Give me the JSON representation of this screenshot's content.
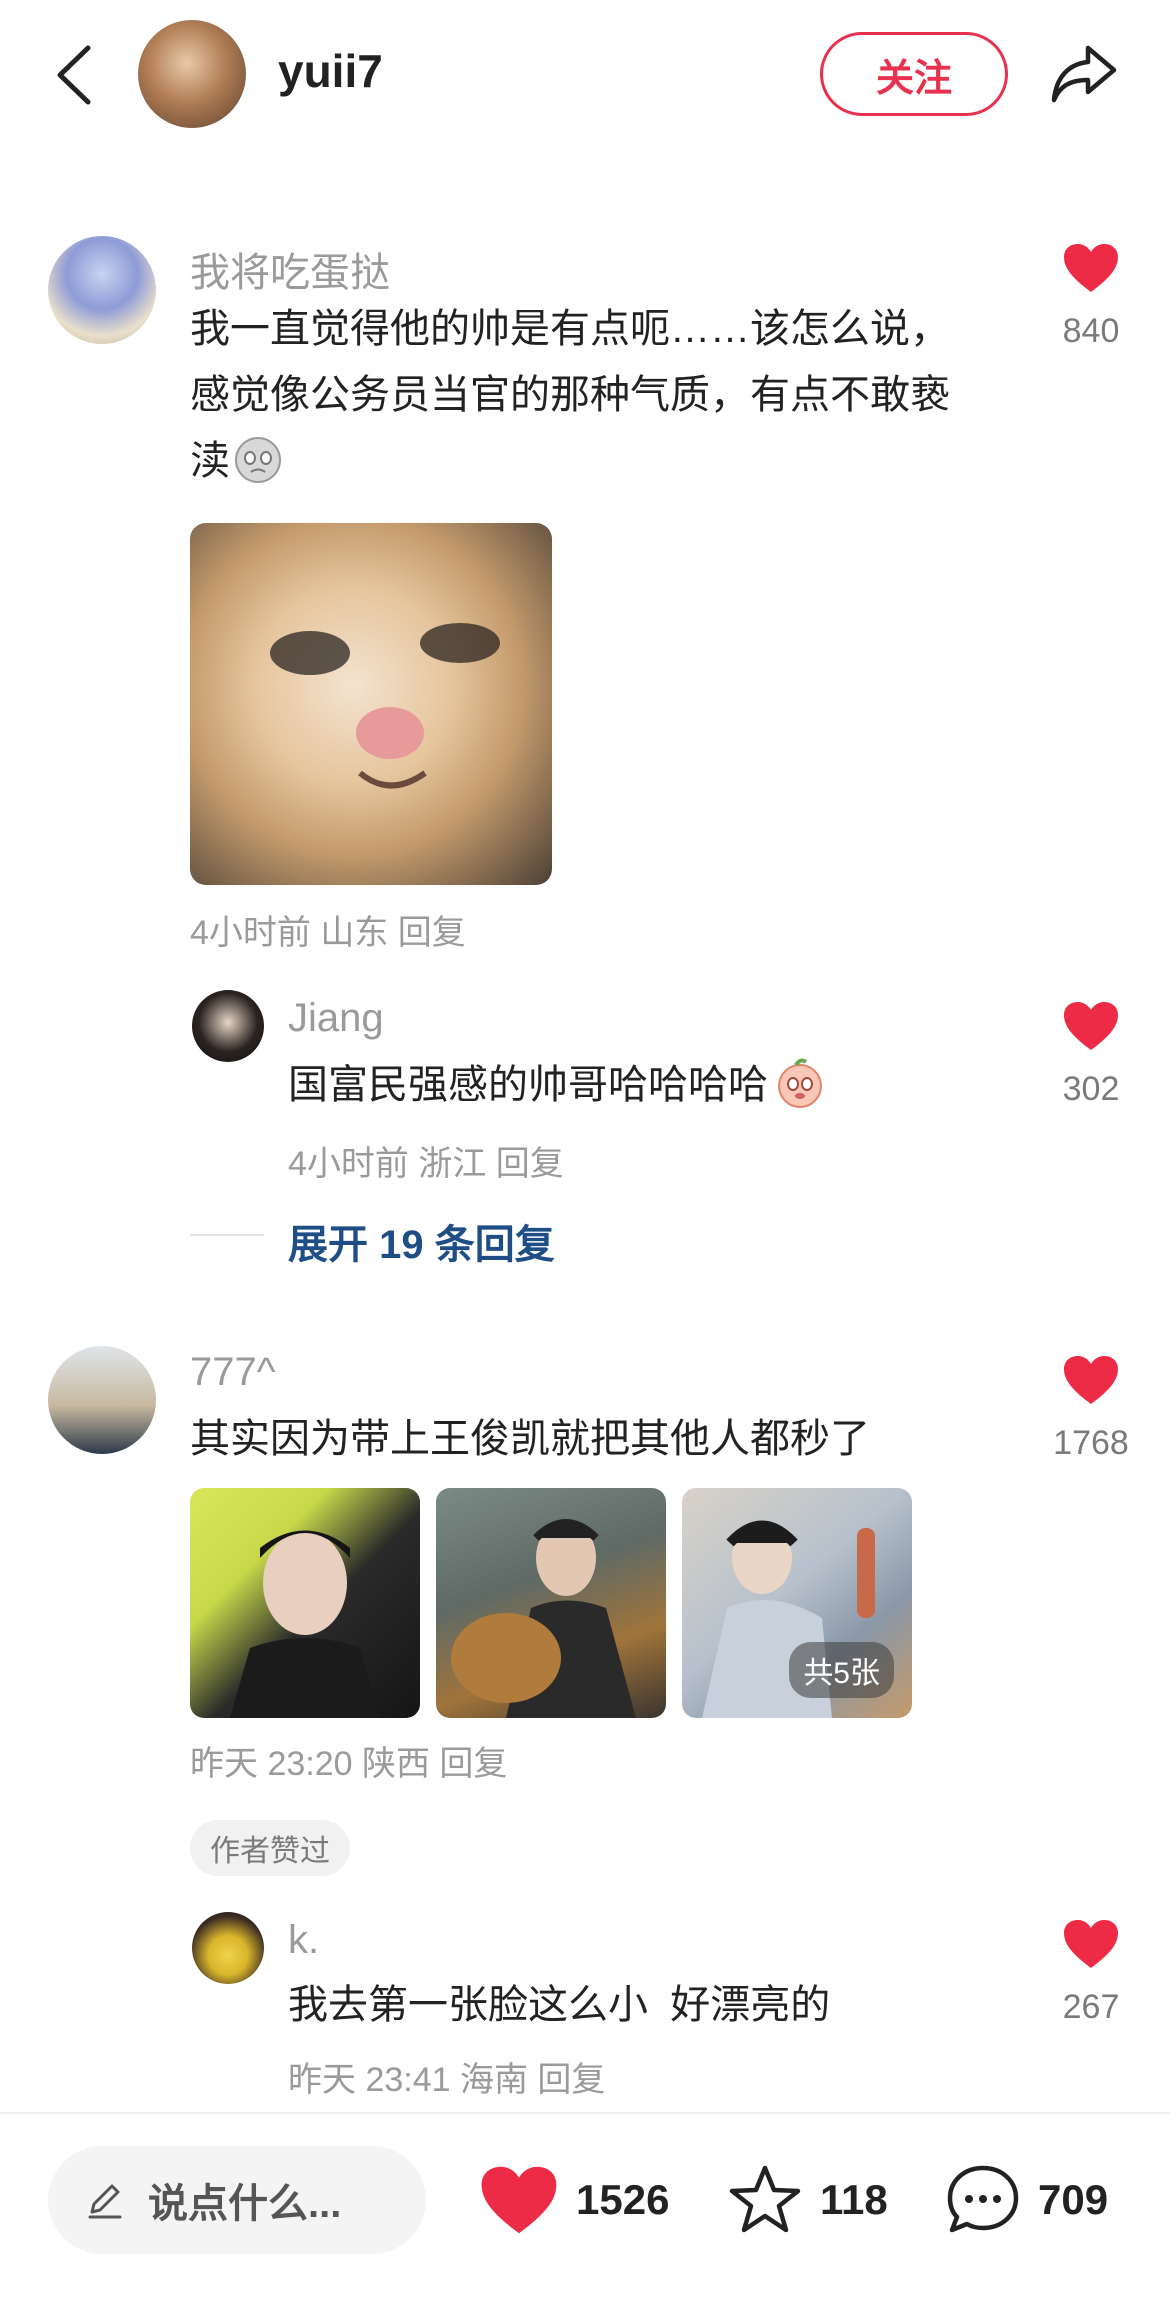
{
  "header": {
    "username": "yuii7",
    "follow_label": "关注"
  },
  "comments": [
    {
      "author": "我将吃蛋挞",
      "text_lines": [
        "我一直觉得他的帅是有点呃……该怎么说，",
        "感觉像公务员当官的那种气质，有点不敢亵",
        "渎"
      ],
      "meta": "4小时前 山东 回复",
      "likes": "840",
      "reply": {
        "author": "Jiang",
        "text": "国富民强感的帅哥哈哈哈哈",
        "meta": "4小时前 浙江 回复",
        "likes": "302"
      },
      "expand_label": "展开 19 条回复"
    },
    {
      "author": "777^",
      "text": "其实因为带上王俊凯就把其他人都秒了",
      "image_count_label": "共5张",
      "meta": "昨天 23:20 陕西 回复",
      "likes": "1768",
      "author_tag": "作者赞过",
      "reply": {
        "author": "k.",
        "text": "我去第一张脸这么小  好漂亮的",
        "meta": "昨天 23:41 海南 回复",
        "likes": "267"
      }
    }
  ],
  "bottom_bar": {
    "input_placeholder": "说点什么...",
    "likes": "1526",
    "favorites": "118",
    "comments": "709"
  },
  "colors": {
    "accent": "#e8304f",
    "link": "#1f4e86",
    "muted": "#9a9a9a"
  },
  "icons": [
    "back-icon",
    "share-icon",
    "heart-icon",
    "star-icon",
    "comment-bubble-icon",
    "pencil-icon"
  ]
}
